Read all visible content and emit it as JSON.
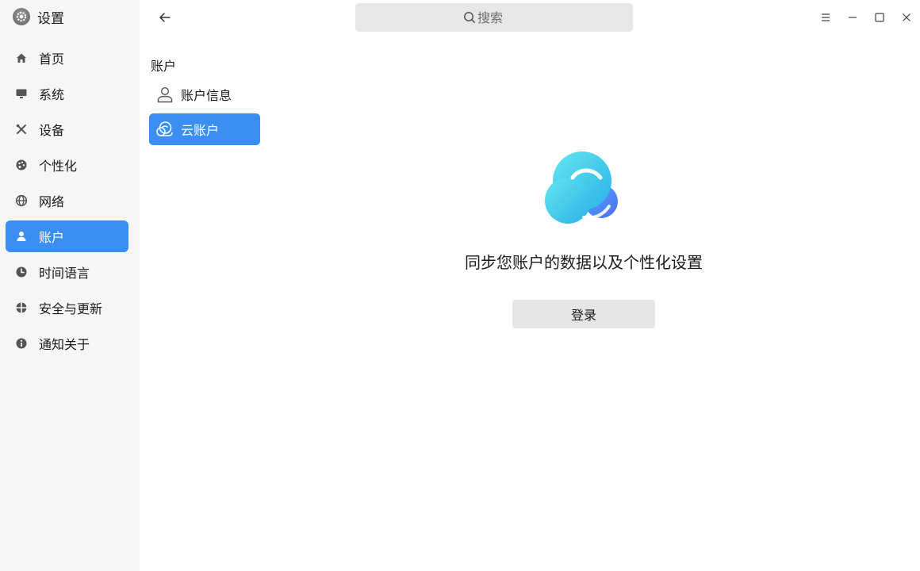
{
  "app": {
    "title": "设置",
    "icon": "gear-icon"
  },
  "sidebar": {
    "items": [
      {
        "label": "首页",
        "icon": "home-icon",
        "active": false
      },
      {
        "label": "系统",
        "icon": "monitor-icon",
        "active": false
      },
      {
        "label": "设备",
        "icon": "tools-icon",
        "active": false
      },
      {
        "label": "个性化",
        "icon": "palette-icon",
        "active": false
      },
      {
        "label": "网络",
        "icon": "globe-icon",
        "active": false
      },
      {
        "label": "账户",
        "icon": "user-icon",
        "active": true
      },
      {
        "label": "时间语言",
        "icon": "clock-icon",
        "active": false
      },
      {
        "label": "安全与更新",
        "icon": "shield-icon",
        "active": false
      },
      {
        "label": "通知关于",
        "icon": "info-icon",
        "active": false
      }
    ]
  },
  "toolbar": {
    "back_icon": "arrow-left-icon",
    "search": {
      "placeholder": "搜索",
      "icon": "search-icon"
    },
    "window_controls": [
      "menu-icon",
      "minimize-icon",
      "maximize-icon",
      "close-icon"
    ]
  },
  "accounts": {
    "section_title": "账户",
    "items": [
      {
        "label": "账户信息",
        "icon": "person-outline-icon",
        "active": false
      },
      {
        "label": "云账户",
        "icon": "cloud-outline-icon",
        "active": true
      }
    ]
  },
  "cloud": {
    "tagline": "同步您账户的数据以及个性化设置",
    "login_label": "登录",
    "logo": "cloud-logo-icon"
  },
  "colors": {
    "accent": "#3b8ff3",
    "sidebar_bg": "#f6f6f6",
    "search_bg": "#e7e7e7",
    "button_bg": "#e6e6e6"
  }
}
